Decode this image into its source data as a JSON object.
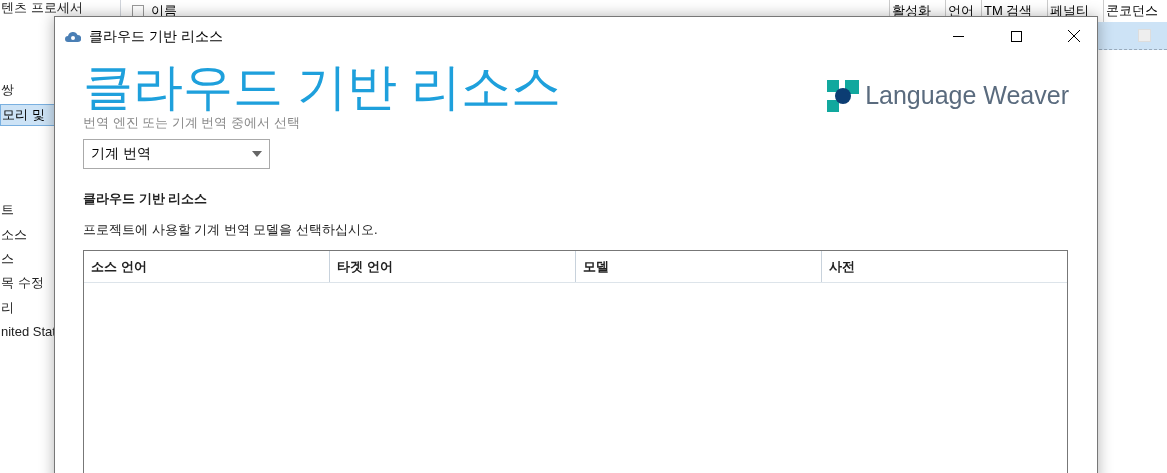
{
  "background_app": {
    "tree_items": [
      {
        "label": "텐츠 프로세서",
        "selected": false
      },
      {
        "label": "쌍",
        "selected": false
      },
      {
        "label": "모리 및",
        "selected": true
      },
      {
        "label": "트",
        "selected": false
      },
      {
        "label": "소스",
        "selected": false
      },
      {
        "label": "스",
        "selected": false
      },
      {
        "label": "목 수정",
        "selected": false
      },
      {
        "label": "리",
        "selected": false
      },
      {
        "label": "nited Stat",
        "selected": false
      }
    ],
    "grid_columns": [
      "이름",
      "활성화",
      "언어",
      "TM 검색",
      "페널티",
      "콘코던스"
    ],
    "header_checkbox": {
      "checked": false
    },
    "row_checkbox": {
      "checked": false
    }
  },
  "dialog": {
    "title": "클라우드 기반 리소스",
    "heading": "클라우드 기반 리소스",
    "logo_text": "Language Weaver",
    "engine_label": "번역 엔진 또는 기계 번역 중에서 선택",
    "engine_select": {
      "value": "기계 번역"
    },
    "section_title": "클라우드 기반 리소스",
    "instruction": "프로젝트에 사용할 기계 번역 모델을 선택하십시오.",
    "table": {
      "columns": [
        "소스 언어",
        "타겟 언어",
        "모델",
        "사전"
      ]
    }
  }
}
